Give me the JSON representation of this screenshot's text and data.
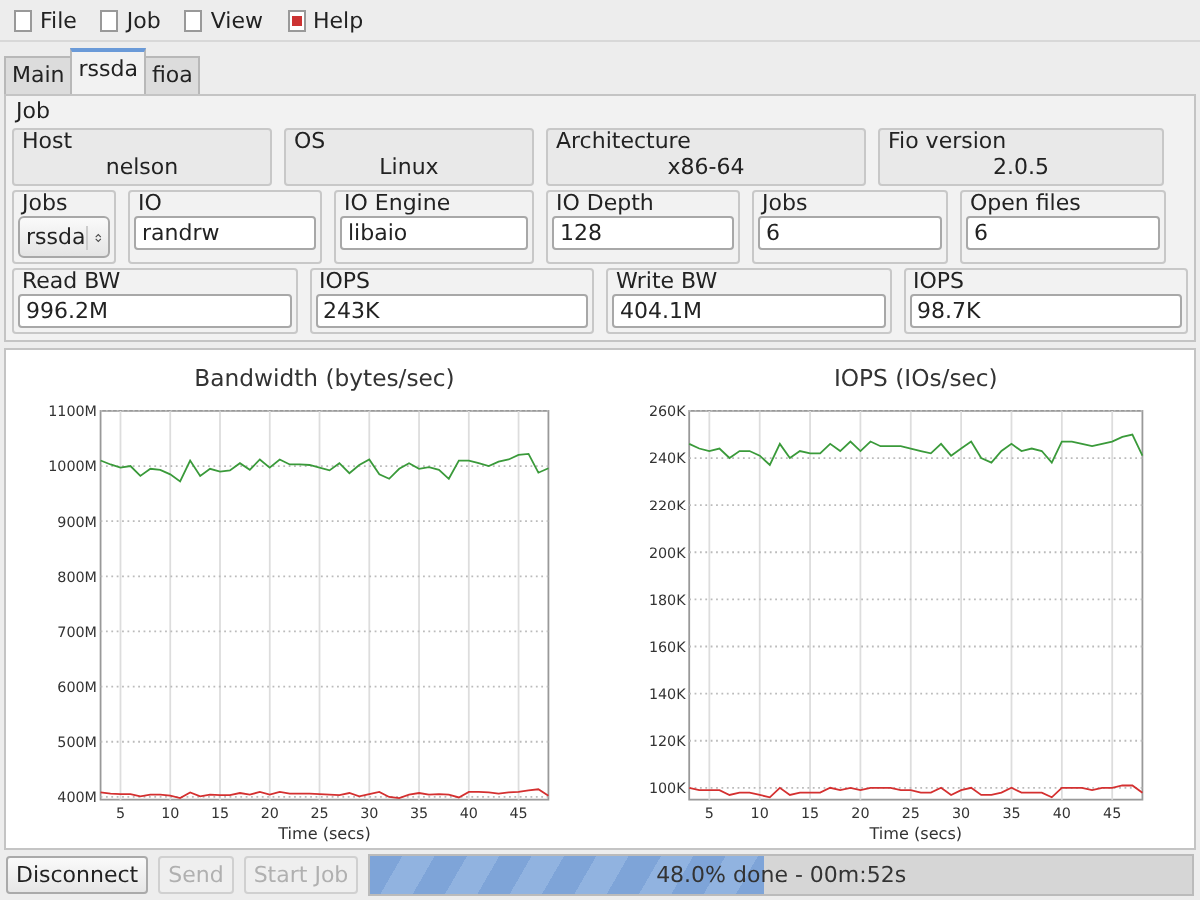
{
  "menu": [
    {
      "label": "File"
    },
    {
      "label": "Job"
    },
    {
      "label": "View"
    },
    {
      "label": "Help"
    }
  ],
  "tabs": [
    {
      "label": "Main",
      "selected": false
    },
    {
      "label": "rssda",
      "selected": true
    },
    {
      "label": "fioa",
      "selected": false
    }
  ],
  "job": {
    "title": "Job",
    "info": [
      {
        "label": "Host",
        "value": "nelson"
      },
      {
        "label": "OS",
        "value": "Linux"
      },
      {
        "label": "Architecture",
        "value": "x86-64"
      },
      {
        "label": "Fio version",
        "value": "2.0.5"
      }
    ],
    "config": [
      {
        "label": "Jobs",
        "value": "rssda",
        "kind": "select"
      },
      {
        "label": "IO",
        "value": "randrw",
        "kind": "input"
      },
      {
        "label": "IO Engine",
        "value": "libaio",
        "kind": "input"
      },
      {
        "label": "IO Depth",
        "value": "128",
        "kind": "input"
      },
      {
        "label": "Jobs",
        "value": "6",
        "kind": "input"
      },
      {
        "label": "Open files",
        "value": "6",
        "kind": "input"
      }
    ],
    "stats": [
      {
        "label": "Read BW",
        "value": "996.2M"
      },
      {
        "label": "IOPS",
        "value": "243K"
      },
      {
        "label": "Write BW",
        "value": "404.1M"
      },
      {
        "label": "IOPS",
        "value": "98.7K"
      }
    ]
  },
  "charts": [
    {
      "chart_data": {
        "type": "line",
        "grid": true,
        "title": "Bandwidth (bytes/sec)",
        "xlabel": "Time (secs)",
        "xlim": [
          3,
          48
        ],
        "ylim": [
          395,
          1100
        ],
        "x": [
          3,
          4,
          5,
          6,
          7,
          8,
          9,
          10,
          11,
          12,
          13,
          14,
          15,
          16,
          17,
          18,
          19,
          20,
          21,
          22,
          23,
          24,
          25,
          26,
          27,
          28,
          29,
          30,
          31,
          32,
          33,
          34,
          35,
          36,
          37,
          38,
          39,
          40,
          41,
          42,
          43,
          44,
          45,
          46,
          47,
          48
        ],
        "xticks": [
          5,
          10,
          15,
          20,
          25,
          30,
          35,
          40,
          45
        ],
        "yticks": [
          {
            "value": 400,
            "label": "400M"
          },
          {
            "value": 500,
            "label": "500M"
          },
          {
            "value": 600,
            "label": "600M"
          },
          {
            "value": 700,
            "label": "700M"
          },
          {
            "value": 800,
            "label": "800M"
          },
          {
            "value": 900,
            "label": "900M"
          },
          {
            "value": 1000,
            "label": "1000M"
          },
          {
            "value": 1100,
            "label": "1100M"
          }
        ],
        "series": [
          {
            "color": "#3a9a3a",
            "values": [
              1010,
              1003,
              997,
              1000,
              982,
              995,
              993,
              985,
              972,
              1010,
              982,
              995,
              990,
              992,
              1005,
              993,
              1012,
              997,
              1012,
              1003,
              1003,
              1002,
              997,
              992,
              1005,
              987,
              1002,
              1012,
              985,
              977,
              995,
              1005,
              995,
              998,
              993,
              977,
              1010,
              1010,
              1005,
              1000,
              1008,
              1012,
              1020,
              1022,
              988,
              996
            ]
          },
          {
            "color": "#d43030",
            "values": [
              408,
              406,
              405,
              405,
              401,
              404,
              404,
              402,
              398,
              408,
              401,
              404,
              403,
              403,
              407,
              404,
              409,
              404,
              409,
              406,
              406,
              406,
              405,
              404,
              403,
              407,
              401,
              405,
              409,
              400,
              398,
              404,
              407,
              404,
              405,
              404,
              399,
              409,
              409,
              408,
              406,
              408,
              409,
              412,
              414,
              402
            ]
          }
        ]
      }
    },
    {
      "chart_data": {
        "type": "line",
        "grid": true,
        "title": "IOPS (IOs/sec)",
        "xlabel": "Time (secs)",
        "xlim": [
          3,
          48
        ],
        "ylim": [
          95,
          260
        ],
        "x": [
          3,
          4,
          5,
          6,
          7,
          8,
          9,
          10,
          11,
          12,
          13,
          14,
          15,
          16,
          17,
          18,
          19,
          20,
          21,
          22,
          23,
          24,
          25,
          26,
          27,
          28,
          29,
          30,
          31,
          32,
          33,
          34,
          35,
          36,
          37,
          38,
          39,
          40,
          41,
          42,
          43,
          44,
          45,
          46,
          47,
          48
        ],
        "xticks": [
          5,
          10,
          15,
          20,
          25,
          30,
          35,
          40,
          45
        ],
        "yticks": [
          {
            "value": 100,
            "label": "100K"
          },
          {
            "value": 120,
            "label": "120K"
          },
          {
            "value": 140,
            "label": "140K"
          },
          {
            "value": 160,
            "label": "160K"
          },
          {
            "value": 180,
            "label": "180K"
          },
          {
            "value": 200,
            "label": "200K"
          },
          {
            "value": 220,
            "label": "220K"
          },
          {
            "value": 240,
            "label": "240K"
          },
          {
            "value": 260,
            "label": "260K"
          }
        ],
        "series": [
          {
            "color": "#3a9a3a",
            "values": [
              246,
              244,
              243,
              244,
              240,
              243,
              243,
              241,
              237,
              246,
              240,
              243,
              242,
              242,
              246,
              243,
              247,
              243,
              247,
              245,
              245,
              245,
              244,
              243,
              242,
              246,
              241,
              244,
              247,
              240,
              238,
              243,
              246,
              243,
              244,
              243,
              238,
              247,
              247,
              246,
              245,
              246,
              247,
              249,
              250,
              241
            ]
          },
          {
            "color": "#d43030",
            "values": [
              100,
              99,
              99,
              99,
              97,
              98,
              98,
              97,
              96,
              100,
              97,
              98,
              98,
              98,
              100,
              99,
              100,
              99,
              100,
              100,
              100,
              99,
              99,
              98,
              98,
              100,
              97,
              99,
              100,
              97,
              97,
              98,
              100,
              98,
              98,
              98,
              96,
              100,
              100,
              100,
              99,
              100,
              100,
              101,
              101,
              98
            ]
          }
        ]
      }
    }
  ],
  "footer": {
    "buttons": [
      {
        "label": "Disconnect",
        "disabled": false
      },
      {
        "label": "Send",
        "disabled": true
      },
      {
        "label": "Start Job",
        "disabled": true
      }
    ],
    "progress": {
      "level": 0.48,
      "text": "48.0% done - 00m:52s"
    }
  }
}
